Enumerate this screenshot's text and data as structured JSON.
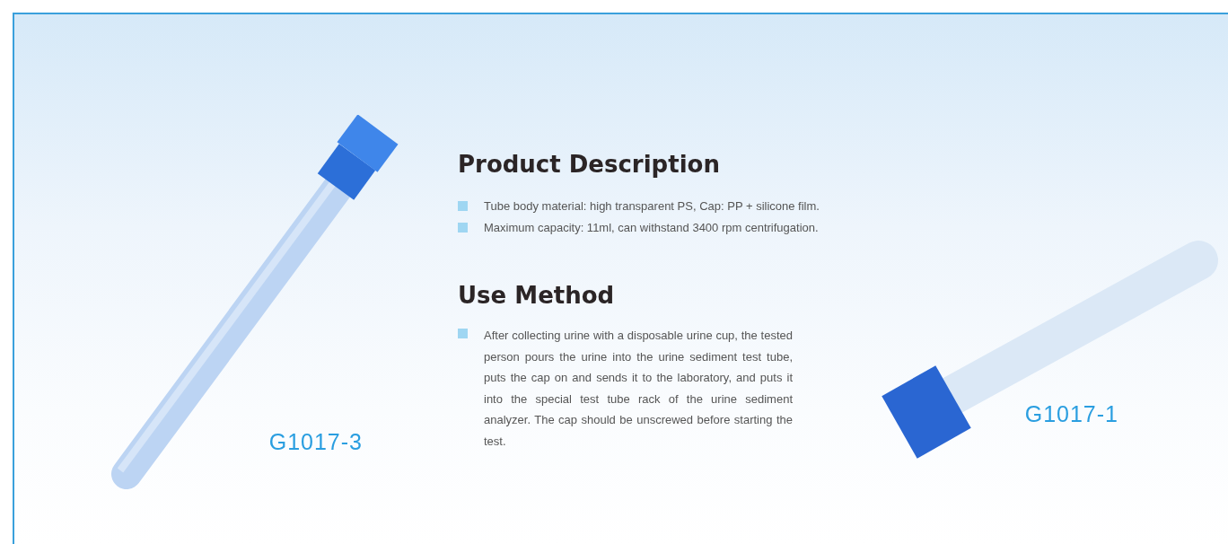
{
  "left_product": {
    "label": "G1017-3"
  },
  "sections": [
    {
      "heading": "Product Description",
      "items": [
        "Tube body material: high transparent PS, Cap: PP + silicone film.",
        "Maximum capacity: 11ml, can withstand 3400 rpm centrifugation."
      ]
    },
    {
      "heading": "Use Method",
      "items": [
        "After collecting urine with a disposable urine cup, the tested person pours the urine into the urine sediment test tube, puts the cap on and sends it to the laboratory, and puts it into the special test tube rack of the urine sediment analyzer. The cap should be unscrewed before starting the test."
      ]
    }
  ],
  "right_product": {
    "label": "G1017-1"
  }
}
